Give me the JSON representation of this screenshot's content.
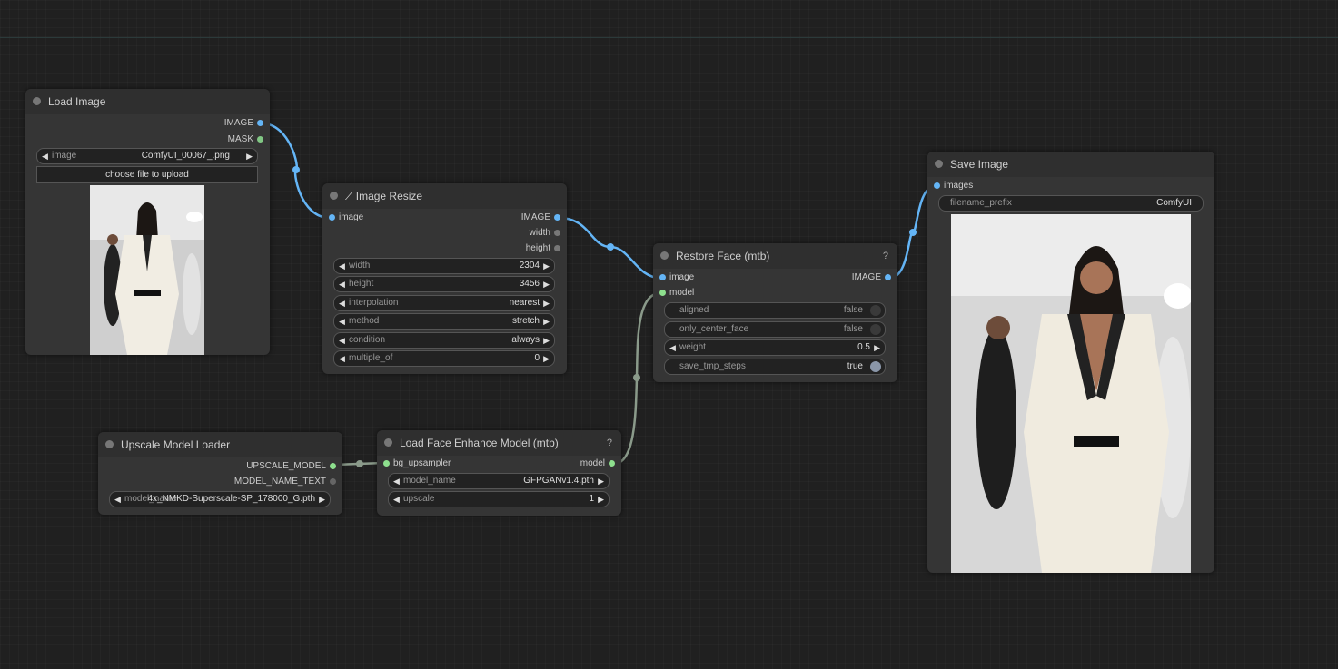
{
  "colors": {
    "image_link": "#64b5f6",
    "model_link": "#8a9a8a",
    "mask": "#81c784"
  },
  "load_image": {
    "title": "Load Image",
    "outputs": [
      "IMAGE",
      "MASK"
    ],
    "image_label": "image",
    "image_value": "ComfyUI_00067_.png",
    "upload_label": "choose file to upload"
  },
  "image_resize": {
    "title": "Image Resize",
    "title_icon": "wand-icon",
    "input": "image",
    "outputs": [
      "IMAGE",
      "width",
      "height"
    ],
    "widgets": [
      {
        "label": "width",
        "value": "2304"
      },
      {
        "label": "height",
        "value": "3456"
      },
      {
        "label": "interpolation",
        "value": "nearest"
      },
      {
        "label": "method",
        "value": "stretch"
      },
      {
        "label": "condition",
        "value": "always"
      },
      {
        "label": "multiple_of",
        "value": "0"
      }
    ]
  },
  "restore_face": {
    "title": "Restore Face (mtb)",
    "help": "?",
    "inputs": [
      "image",
      "model"
    ],
    "output": "IMAGE",
    "aligned": {
      "label": "aligned",
      "value": "false"
    },
    "only_center_face": {
      "label": "only_center_face",
      "value": "false"
    },
    "weight": {
      "label": "weight",
      "value": "0.5"
    },
    "save_tmp_steps": {
      "label": "save_tmp_steps",
      "value": "true"
    }
  },
  "save_image": {
    "title": "Save Image",
    "input": "images",
    "filename_prefix": {
      "label": "filename_prefix",
      "value": "ComfyUI"
    }
  },
  "upscale_loader": {
    "title": "Upscale Model Loader",
    "outputs": [
      "UPSCALE_MODEL",
      "MODEL_NAME_TEXT"
    ],
    "model_name_label": "model_name",
    "model_name_value": "4x_NMKD-Superscale-SP_178000_G.pth"
  },
  "face_enhance": {
    "title": "Load Face Enhance Model (mtb)",
    "help": "?",
    "input": "bg_upsampler",
    "output": "model",
    "model_name": {
      "label": "model_name",
      "value": "GFPGANv1.4.pth"
    },
    "upscale": {
      "label": "upscale",
      "value": "1"
    }
  }
}
